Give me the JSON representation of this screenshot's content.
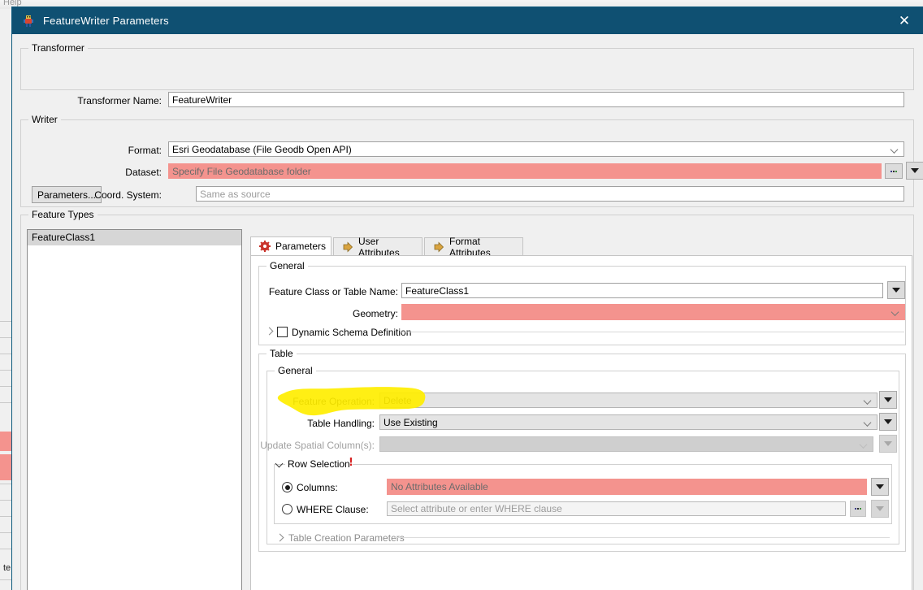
{
  "background": {
    "menu_item": "Help",
    "sliver_text": "te"
  },
  "window": {
    "title": "FeatureWriter Parameters",
    "icon": "fme-transformer-icon",
    "close_label": "✕",
    "titlebar_color": "#0f5072"
  },
  "transformer_group": {
    "legend": "Transformer",
    "name_label": "Transformer Name:",
    "name_value": "FeatureWriter"
  },
  "writer_group": {
    "legend": "Writer",
    "format_label": "Format:",
    "format_value": "Esri Geodatabase (File Geodb Open API)",
    "dataset_label": "Dataset:",
    "dataset_value": "Specify File Geodatabase folder",
    "dataset_error_color": "#f4938e",
    "browse_label": "...",
    "parameters_button": "Parameters...",
    "coordsys_label": "Coord. System:",
    "coordsys_placeholder": "Same as source"
  },
  "feature_types_group": {
    "legend": "Feature Types",
    "items": [
      {
        "label": "FeatureClass1",
        "selected": true
      }
    ]
  },
  "tabs": [
    {
      "label": "Parameters",
      "icon": "gear-icon",
      "active": true
    },
    {
      "label": "User Attributes",
      "icon": "arrow-right-icon",
      "active": false
    },
    {
      "label": "Format Attributes",
      "icon": "arrow-right-icon",
      "active": false
    }
  ],
  "general_group": {
    "legend": "General",
    "feature_class_label": "Feature Class or Table Name:",
    "feature_class_value": "FeatureClass1",
    "geometry_label": "Geometry:",
    "geometry_value": "",
    "geometry_error_color": "#e08a86",
    "dynamic_schema_label": "Dynamic Schema Definition",
    "dynamic_schema_checked": false
  },
  "table_group": {
    "legend": "Table",
    "general_legend": "General",
    "feature_operation_label": "Feature Operation:",
    "feature_operation_value": "Delete",
    "table_handling_label": "Table Handling:",
    "table_handling_value": "Use Existing",
    "update_spatial_label": "Update Spatial Column(s):",
    "update_spatial_value": "",
    "row_selection_legend": "Row Selection",
    "row_selection_warning": "!",
    "columns_label": "Columns:",
    "columns_value": "No Attributes Available",
    "columns_selected": true,
    "where_label": "WHERE Clause:",
    "where_placeholder": "Select attribute or enter WHERE clause",
    "where_selected": false,
    "where_browse_label": "...",
    "table_creation_legend": "Table Creation Parameters"
  },
  "annotation": {
    "highlight_color": "#ffee00",
    "target": "Feature Operation: Delete"
  }
}
